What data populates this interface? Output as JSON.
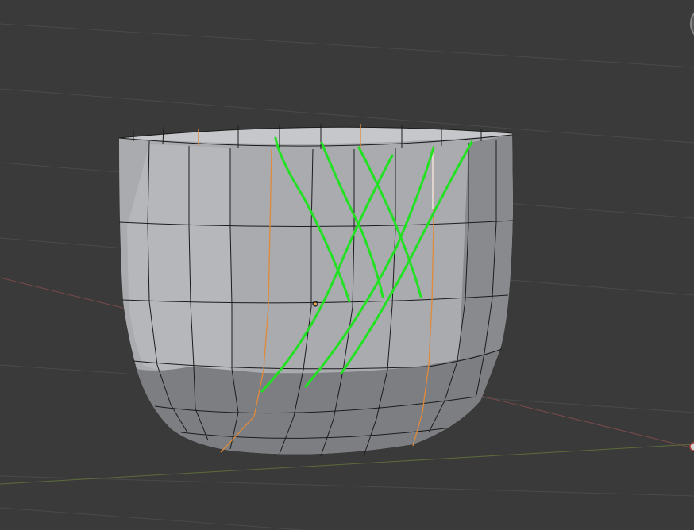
{
  "viewport": {
    "background": "#3a3a3a",
    "grid_color": "#494949",
    "x_axis_color": "#7a4a4a",
    "y_axis_color": "#5c6b3a"
  },
  "mesh": {
    "face_light": "#b9bbbf",
    "face_mid": "#9a9ca0",
    "face_dark": "#6f7175",
    "edge_color": "#1c1c1c",
    "seam_color": "#e08a3a"
  },
  "annotation": {
    "stroke_color": "#22e022"
  },
  "icons": {
    "origin": "origin-icon",
    "gizmo": "navigation-gizmo-icon",
    "light": "light-icon"
  }
}
